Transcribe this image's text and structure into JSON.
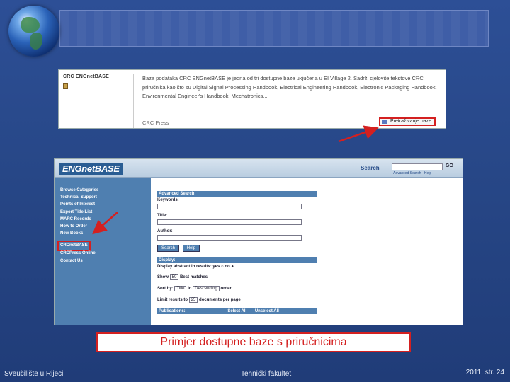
{
  "shot1": {
    "title": "CRC ENGnetBASE",
    "description": "Baza podataka CRC ENGnetBASE je jedna od tri dostupne baze ukjučena u EI Village 2. Sadrži cjelovite tekstove CRC priručnika kao što su Digital Signal Processing Handbook, Electrical Engineering Handbook, Electronic Packaging Handbook, Environmental Engineer's Handbook, Mechatronics...",
    "publisher": "CRC Press",
    "browse_label": "Pretraživanje baze"
  },
  "shot2": {
    "logo": "ENGnetBASE",
    "search_label": "Search",
    "go_label": "GO",
    "adv_links": "Advanced Search · Help",
    "nav": [
      "Browse Categories",
      "Technical Support",
      "Points of Interest",
      "Export Title List",
      "MARC Records",
      "How to Order",
      "New Books",
      "CRCnetBASE",
      "CRCPress Online",
      "Contact Us"
    ],
    "form": {
      "header": "Advanced Search",
      "keywords": "Keywords:",
      "title": "Title:",
      "author": "Author:",
      "search_btn": "Search",
      "help_btn": "Help",
      "display_header": "Display:",
      "display_abstract": "Display abstract in results:  yes ○  no ●",
      "show_label": "Show",
      "show_value": "50",
      "show_suffix": "Best matches",
      "sort_label": "Sort by:",
      "sort_value": "Title",
      "sort_in": "in",
      "order_value": "Descending",
      "order_label": "order",
      "limit_label": "Limit results to",
      "limit_value": "25",
      "limit_suffix": "documents per page",
      "pub_header": "Publications:",
      "select_all": "Select All",
      "unselect_all": "Unselect All"
    }
  },
  "caption": "Primjer dostupne baze s priručnicima",
  "footer": {
    "left": "Sveučilište u Rijeci",
    "center": "Tehnički fakultet",
    "right": "2011.  str. 24"
  },
  "colors": {
    "background": "#274787",
    "accent_red": "#d42020",
    "nav_blue": "#4f7fb0"
  }
}
